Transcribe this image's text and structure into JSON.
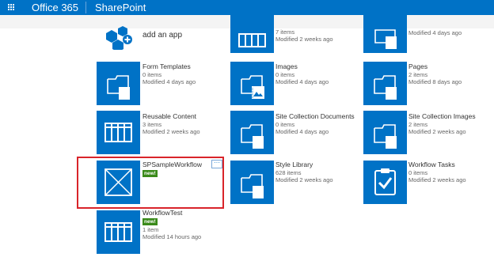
{
  "suitebar": {
    "brand": "Office 365",
    "app": "SharePoint"
  },
  "add_app": {
    "label": "add an app"
  },
  "tiles": [
    {
      "id": "top-mid",
      "title": "",
      "line1": "7 items",
      "line2": "Modified 2 weeks ago",
      "icon": "table-icon"
    },
    {
      "id": "top-right",
      "title": "",
      "line1": "",
      "line2": "Modified 4 days ago",
      "icon": "folder-icon"
    },
    {
      "id": "form-templates",
      "title": "Form Templates",
      "line1": "0 items",
      "line2": "Modified 4 days ago",
      "icon": "folder-icon"
    },
    {
      "id": "images",
      "title": "Images",
      "line1": "0 items",
      "line2": "Modified 4 days ago",
      "icon": "image-folder-icon"
    },
    {
      "id": "pages",
      "title": "Pages",
      "line1": "2 items",
      "line2": "Modified 8 days ago",
      "icon": "folder-icon"
    },
    {
      "id": "reusable-content",
      "title": "Reusable Content",
      "line1": "3 items",
      "line2": "Modified 2 weeks ago",
      "icon": "table-icon"
    },
    {
      "id": "site-collection-documents",
      "title": "Site Collection Documents",
      "line1": "0 items",
      "line2": "Modified 4 days ago",
      "icon": "folder-icon"
    },
    {
      "id": "site-collection-images",
      "title": "Site Collection Images",
      "line1": "2 items",
      "line2": "Modified 2 weeks ago",
      "icon": "folder-icon"
    },
    {
      "id": "spsampleworkflow",
      "title": "SPSampleWorkflow",
      "badge": "new!",
      "icon": "app-placeholder-icon"
    },
    {
      "id": "style-library",
      "title": "Style Library",
      "line1": "628 items",
      "line2": "Modified 2 weeks ago",
      "icon": "folder-icon"
    },
    {
      "id": "workflow-tasks",
      "title": "Workflow Tasks",
      "line1": "0 items",
      "line2": "Modified 2 weeks ago",
      "icon": "clipboard-check-icon"
    },
    {
      "id": "workflowtest",
      "title": "WorkflowTest",
      "badge": "new!",
      "line1": "1 item",
      "line2": "Modified 14 hours ago",
      "icon": "table-icon"
    }
  ],
  "ellipsis": "···",
  "colors": {
    "suitebar": "#0072c6",
    "tile": "#0072c6",
    "badge": "#3a8a1a",
    "highlight": "#d9242a"
  }
}
